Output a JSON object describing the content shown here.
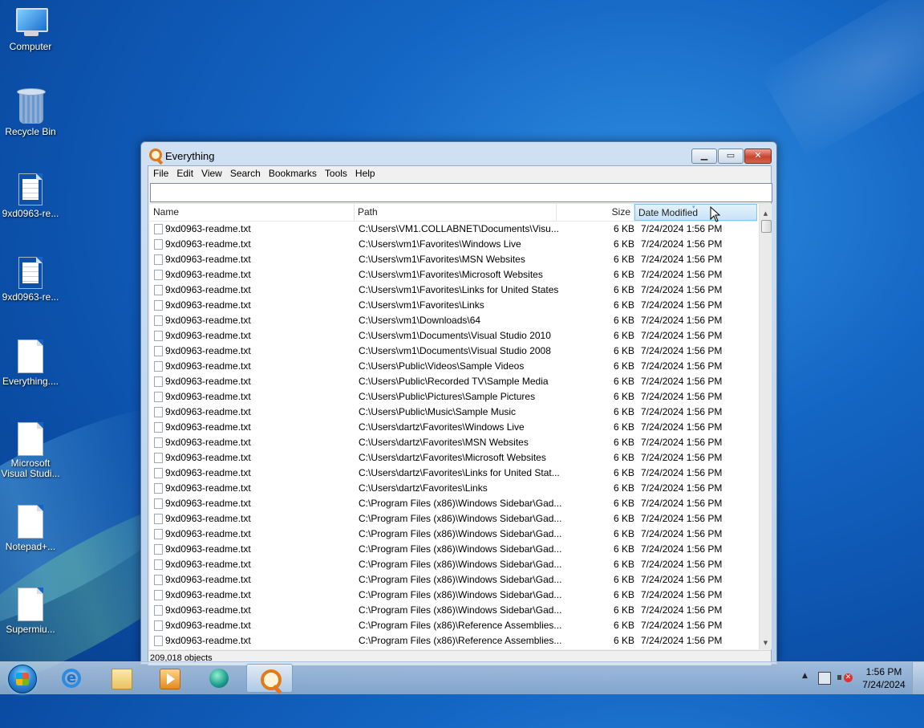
{
  "desktop": {
    "icons": [
      {
        "label": "Computer"
      },
      {
        "label": "Recycle Bin"
      },
      {
        "label": "9xd0963-re..."
      },
      {
        "label": "9xd0963-re..."
      },
      {
        "label": "Everything...."
      },
      {
        "label": "Microsoft Visual Studi..."
      },
      {
        "label": "Notepad+..."
      },
      {
        "label": "Supermiu..."
      }
    ]
  },
  "window": {
    "title": "Everything",
    "menu": [
      "File",
      "Edit",
      "View",
      "Search",
      "Bookmarks",
      "Tools",
      "Help"
    ],
    "search": {
      "value": "",
      "placeholder": ""
    },
    "columns": {
      "name": "Name",
      "path": "Path",
      "size": "Size",
      "date": "Date Modified"
    },
    "sorted_column": "Date Modified",
    "rows": [
      {
        "name": "9xd0963-readme.txt",
        "path": "C:\\Users\\VM1.COLLABNET\\Documents\\Visu...",
        "size": "6 KB",
        "date": "7/24/2024 1:56 PM"
      },
      {
        "name": "9xd0963-readme.txt",
        "path": "C:\\Users\\vm1\\Favorites\\Windows Live",
        "size": "6 KB",
        "date": "7/24/2024 1:56 PM"
      },
      {
        "name": "9xd0963-readme.txt",
        "path": "C:\\Users\\vm1\\Favorites\\MSN Websites",
        "size": "6 KB",
        "date": "7/24/2024 1:56 PM"
      },
      {
        "name": "9xd0963-readme.txt",
        "path": "C:\\Users\\vm1\\Favorites\\Microsoft Websites",
        "size": "6 KB",
        "date": "7/24/2024 1:56 PM"
      },
      {
        "name": "9xd0963-readme.txt",
        "path": "C:\\Users\\vm1\\Favorites\\Links for United States",
        "size": "6 KB",
        "date": "7/24/2024 1:56 PM"
      },
      {
        "name": "9xd0963-readme.txt",
        "path": "C:\\Users\\vm1\\Favorites\\Links",
        "size": "6 KB",
        "date": "7/24/2024 1:56 PM"
      },
      {
        "name": "9xd0963-readme.txt",
        "path": "C:\\Users\\vm1\\Downloads\\64",
        "size": "6 KB",
        "date": "7/24/2024 1:56 PM"
      },
      {
        "name": "9xd0963-readme.txt",
        "path": "C:\\Users\\vm1\\Documents\\Visual Studio 2010",
        "size": "6 KB",
        "date": "7/24/2024 1:56 PM"
      },
      {
        "name": "9xd0963-readme.txt",
        "path": "C:\\Users\\vm1\\Documents\\Visual Studio 2008",
        "size": "6 KB",
        "date": "7/24/2024 1:56 PM"
      },
      {
        "name": "9xd0963-readme.txt",
        "path": "C:\\Users\\Public\\Videos\\Sample Videos",
        "size": "6 KB",
        "date": "7/24/2024 1:56 PM"
      },
      {
        "name": "9xd0963-readme.txt",
        "path": "C:\\Users\\Public\\Recorded TV\\Sample Media",
        "size": "6 KB",
        "date": "7/24/2024 1:56 PM"
      },
      {
        "name": "9xd0963-readme.txt",
        "path": "C:\\Users\\Public\\Pictures\\Sample Pictures",
        "size": "6 KB",
        "date": "7/24/2024 1:56 PM"
      },
      {
        "name": "9xd0963-readme.txt",
        "path": "C:\\Users\\Public\\Music\\Sample Music",
        "size": "6 KB",
        "date": "7/24/2024 1:56 PM"
      },
      {
        "name": "9xd0963-readme.txt",
        "path": "C:\\Users\\dartz\\Favorites\\Windows Live",
        "size": "6 KB",
        "date": "7/24/2024 1:56 PM"
      },
      {
        "name": "9xd0963-readme.txt",
        "path": "C:\\Users\\dartz\\Favorites\\MSN Websites",
        "size": "6 KB",
        "date": "7/24/2024 1:56 PM"
      },
      {
        "name": "9xd0963-readme.txt",
        "path": "C:\\Users\\dartz\\Favorites\\Microsoft Websites",
        "size": "6 KB",
        "date": "7/24/2024 1:56 PM"
      },
      {
        "name": "9xd0963-readme.txt",
        "path": "C:\\Users\\dartz\\Favorites\\Links for United Stat...",
        "size": "6 KB",
        "date": "7/24/2024 1:56 PM"
      },
      {
        "name": "9xd0963-readme.txt",
        "path": "C:\\Users\\dartz\\Favorites\\Links",
        "size": "6 KB",
        "date": "7/24/2024 1:56 PM"
      },
      {
        "name": "9xd0963-readme.txt",
        "path": "C:\\Program Files (x86)\\Windows Sidebar\\Gad...",
        "size": "6 KB",
        "date": "7/24/2024 1:56 PM"
      },
      {
        "name": "9xd0963-readme.txt",
        "path": "C:\\Program Files (x86)\\Windows Sidebar\\Gad...",
        "size": "6 KB",
        "date": "7/24/2024 1:56 PM"
      },
      {
        "name": "9xd0963-readme.txt",
        "path": "C:\\Program Files (x86)\\Windows Sidebar\\Gad...",
        "size": "6 KB",
        "date": "7/24/2024 1:56 PM"
      },
      {
        "name": "9xd0963-readme.txt",
        "path": "C:\\Program Files (x86)\\Windows Sidebar\\Gad...",
        "size": "6 KB",
        "date": "7/24/2024 1:56 PM"
      },
      {
        "name": "9xd0963-readme.txt",
        "path": "C:\\Program Files (x86)\\Windows Sidebar\\Gad...",
        "size": "6 KB",
        "date": "7/24/2024 1:56 PM"
      },
      {
        "name": "9xd0963-readme.txt",
        "path": "C:\\Program Files (x86)\\Windows Sidebar\\Gad...",
        "size": "6 KB",
        "date": "7/24/2024 1:56 PM"
      },
      {
        "name": "9xd0963-readme.txt",
        "path": "C:\\Program Files (x86)\\Windows Sidebar\\Gad...",
        "size": "6 KB",
        "date": "7/24/2024 1:56 PM"
      },
      {
        "name": "9xd0963-readme.txt",
        "path": "C:\\Program Files (x86)\\Windows Sidebar\\Gad...",
        "size": "6 KB",
        "date": "7/24/2024 1:56 PM"
      },
      {
        "name": "9xd0963-readme.txt",
        "path": "C:\\Program Files (x86)\\Reference Assemblies...",
        "size": "6 KB",
        "date": "7/24/2024 1:56 PM"
      },
      {
        "name": "9xd0963-readme.txt",
        "path": "C:\\Program Files (x86)\\Reference Assemblies...",
        "size": "6 KB",
        "date": "7/24/2024 1:56 PM"
      }
    ],
    "status": "209,018 objects"
  },
  "taskbar": {
    "buttons": [
      {
        "icon": "internet-explorer-icon"
      },
      {
        "icon": "folder-icon"
      },
      {
        "icon": "media-player-icon"
      },
      {
        "icon": "globe-icon"
      },
      {
        "icon": "everything-search-icon",
        "active": true
      }
    ],
    "clock": {
      "time": "1:56 PM",
      "date": "7/24/2024"
    }
  },
  "colors": {
    "desktop_bg": "#1466c4",
    "accent_orange": "#e07a1a",
    "sorted_header": "#c7e3f7",
    "close_button": "#c8452f"
  }
}
